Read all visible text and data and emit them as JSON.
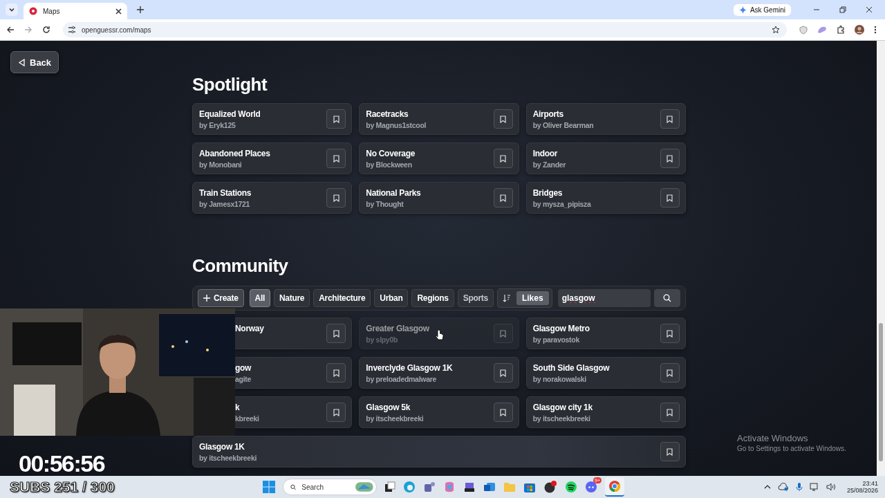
{
  "browser": {
    "tab": {
      "title": "Maps"
    },
    "url": "openguessr.com/maps",
    "gemini_button": "Ask Gemini"
  },
  "back_button": "Back",
  "spotlight": {
    "title": "Spotlight",
    "maps": [
      {
        "title": "Equalized World",
        "author": "by Eryk125"
      },
      {
        "title": "Racetracks",
        "author": "by Magnus1stcool"
      },
      {
        "title": "Airports",
        "author": "by Oliver Bearman"
      },
      {
        "title": "Abandoned Places",
        "author": "by Monobani"
      },
      {
        "title": "No Coverage",
        "author": "by Blockween"
      },
      {
        "title": "Indoor",
        "author": "by Zander"
      },
      {
        "title": "Train Stations",
        "author": "by Jamesx1721"
      },
      {
        "title": "National Parks",
        "author": "by Thought"
      },
      {
        "title": "Bridges",
        "author": "by mysza_pipisza"
      }
    ]
  },
  "community": {
    "title": "Community",
    "create_button": "Create",
    "filters": [
      {
        "label": "All",
        "selected": true
      },
      {
        "label": "Nature",
        "selected": false
      },
      {
        "label": "Architecture",
        "selected": false
      },
      {
        "label": "Urban",
        "selected": false
      },
      {
        "label": "Regions",
        "selected": false
      },
      {
        "label": "Sports",
        "selected": false
      }
    ],
    "sort": {
      "label": "Likes"
    },
    "search": {
      "value": "glasgow"
    },
    "maps": [
      {
        "kind": "covered",
        "title": "Norway",
        "dimmed": false
      },
      {
        "kind": "card",
        "title": "Greater Glasgow",
        "author": "by slpy0b",
        "dimmed": true
      },
      {
        "kind": "card",
        "title": "Glasgow Metro",
        "author": "by paravostok",
        "dimmed": false
      },
      {
        "kind": "covered",
        "title": "gow",
        "author": "agite",
        "dimmed": false
      },
      {
        "kind": "card",
        "title": "Inverclyde Glasgow 1K",
        "author": "by preloadedmalware",
        "dimmed": false
      },
      {
        "kind": "card",
        "title": "South Side Glasgow",
        "author": "by norakowalski",
        "dimmed": false
      },
      {
        "kind": "covered",
        "title": "k",
        "author": "kbreeki",
        "dimmed": false
      },
      {
        "kind": "card",
        "title": "Glasgow 5k",
        "author": "by itscheekbreeki",
        "dimmed": false
      },
      {
        "kind": "card",
        "title": "Glasgow city 1k",
        "author": "by itscheekbreeki",
        "dimmed": false
      },
      {
        "kind": "wide",
        "title": "Glasgow 1K",
        "author": "by itscheekbreeki",
        "dimmed": false
      }
    ]
  },
  "stream": {
    "timer": "00:56:56",
    "subs": "SUBS 251 / 300"
  },
  "windows_notice": {
    "title": "Activate Windows",
    "subtitle": "Go to Settings to activate Windows."
  },
  "taskbar": {
    "search": {
      "placeholder": "Search"
    },
    "discord_badge": "9+",
    "time": "23:41",
    "date": "25/08/2026"
  }
}
